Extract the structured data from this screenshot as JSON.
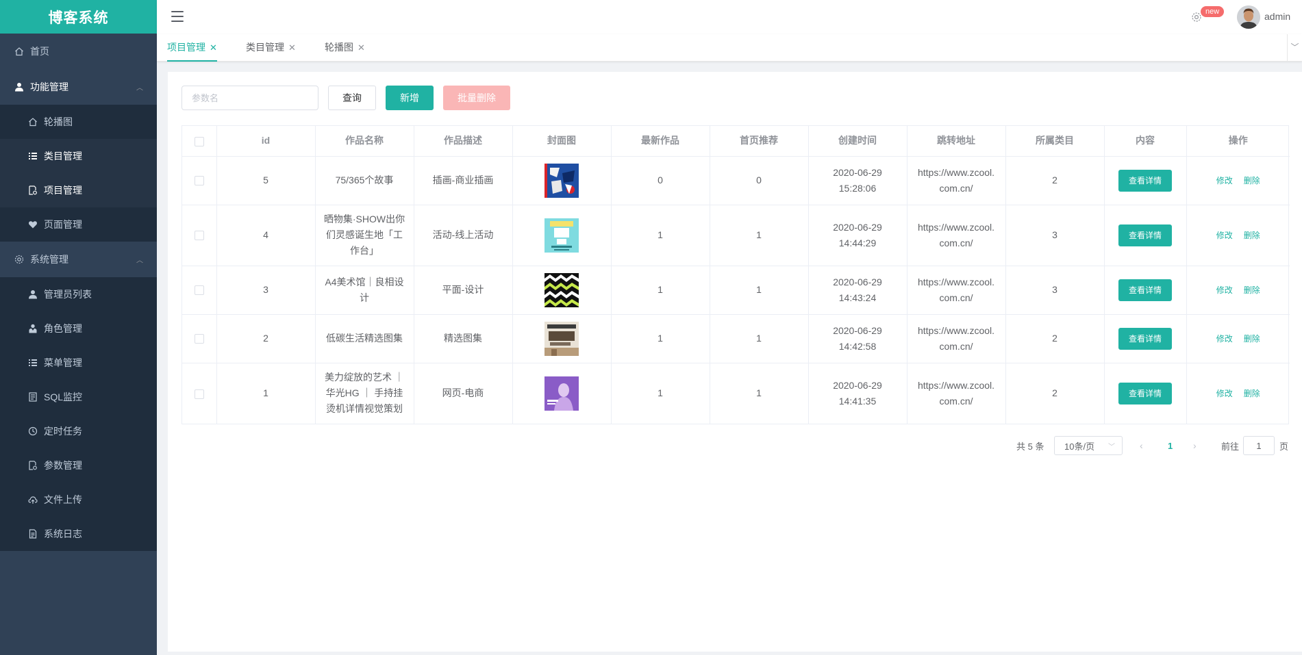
{
  "app": {
    "title": "博客系统"
  },
  "sidebar": {
    "home": "首页",
    "group_func": "功能管理",
    "func_items": [
      "轮播图",
      "类目管理",
      "项目管理",
      "页面管理"
    ],
    "group_sys": "系统管理",
    "sys_items": [
      "管理员列表",
      "角色管理",
      "菜单管理",
      "SQL监控",
      "定时任务",
      "参数管理",
      "文件上传",
      "系统日志"
    ]
  },
  "header": {
    "badge": "new",
    "username": "admin"
  },
  "tabs": [
    {
      "label": "项目管理",
      "active": true
    },
    {
      "label": "类目管理",
      "active": false
    },
    {
      "label": "轮播图",
      "active": false
    }
  ],
  "toolbar": {
    "search_placeholder": "参数名",
    "query_label": "查询",
    "add_label": "新增",
    "batch_delete_label": "批量删除"
  },
  "table": {
    "columns": [
      "id",
      "作品名称",
      "作品描述",
      "封面图",
      "最新作品",
      "首页推荐",
      "创建时间",
      "跳转地址",
      "所属类目",
      "内容",
      "操作"
    ],
    "detail_label": "查看详情",
    "edit_label": "修改",
    "delete_label": "删除",
    "rows": [
      {
        "id": "5",
        "name": "75/365个故事",
        "desc": "插画-商业插画",
        "latest": "0",
        "recommend": "0",
        "created": "2020-06-29 15:28:06",
        "url": "https://www.zcool.com.cn/",
        "category": "2"
      },
      {
        "id": "4",
        "name": "晒物集·SHOW出你们灵感诞生地「工作台」",
        "desc": "活动-线上活动",
        "latest": "1",
        "recommend": "1",
        "created": "2020-06-29 14:44:29",
        "url": "https://www.zcool.com.cn/",
        "category": "3"
      },
      {
        "id": "3",
        "name": "A4美术馆｜良相设计",
        "desc": "平面-设计",
        "latest": "1",
        "recommend": "1",
        "created": "2020-06-29 14:43:24",
        "url": "https://www.zcool.com.cn/",
        "category": "3"
      },
      {
        "id": "2",
        "name": "低碳生活精选图集",
        "desc": "精选图集",
        "latest": "1",
        "recommend": "1",
        "created": "2020-06-29 14:42:58",
        "url": "https://www.zcool.com.cn/",
        "category": "2"
      },
      {
        "id": "1",
        "name": "美力绽放的艺术 ｜ 华光HG ｜ 手持挂烫机详情视觉策划",
        "desc": "网页-电商",
        "latest": "1",
        "recommend": "1",
        "created": "2020-06-29 14:41:35",
        "url": "https://www.zcool.com.cn/",
        "category": "2"
      }
    ]
  },
  "pagination": {
    "total": "共 5 条",
    "page_size": "10条/页",
    "current": "1",
    "goto_label": "前往",
    "goto_value": "1",
    "page_suffix": "页"
  },
  "colors": {
    "primary": "#20b2a3",
    "sidebar_bg": "#304156",
    "submenu_bg": "#1f2d3d",
    "danger_light": "#fab6b6",
    "badge": "#f56c6c"
  }
}
